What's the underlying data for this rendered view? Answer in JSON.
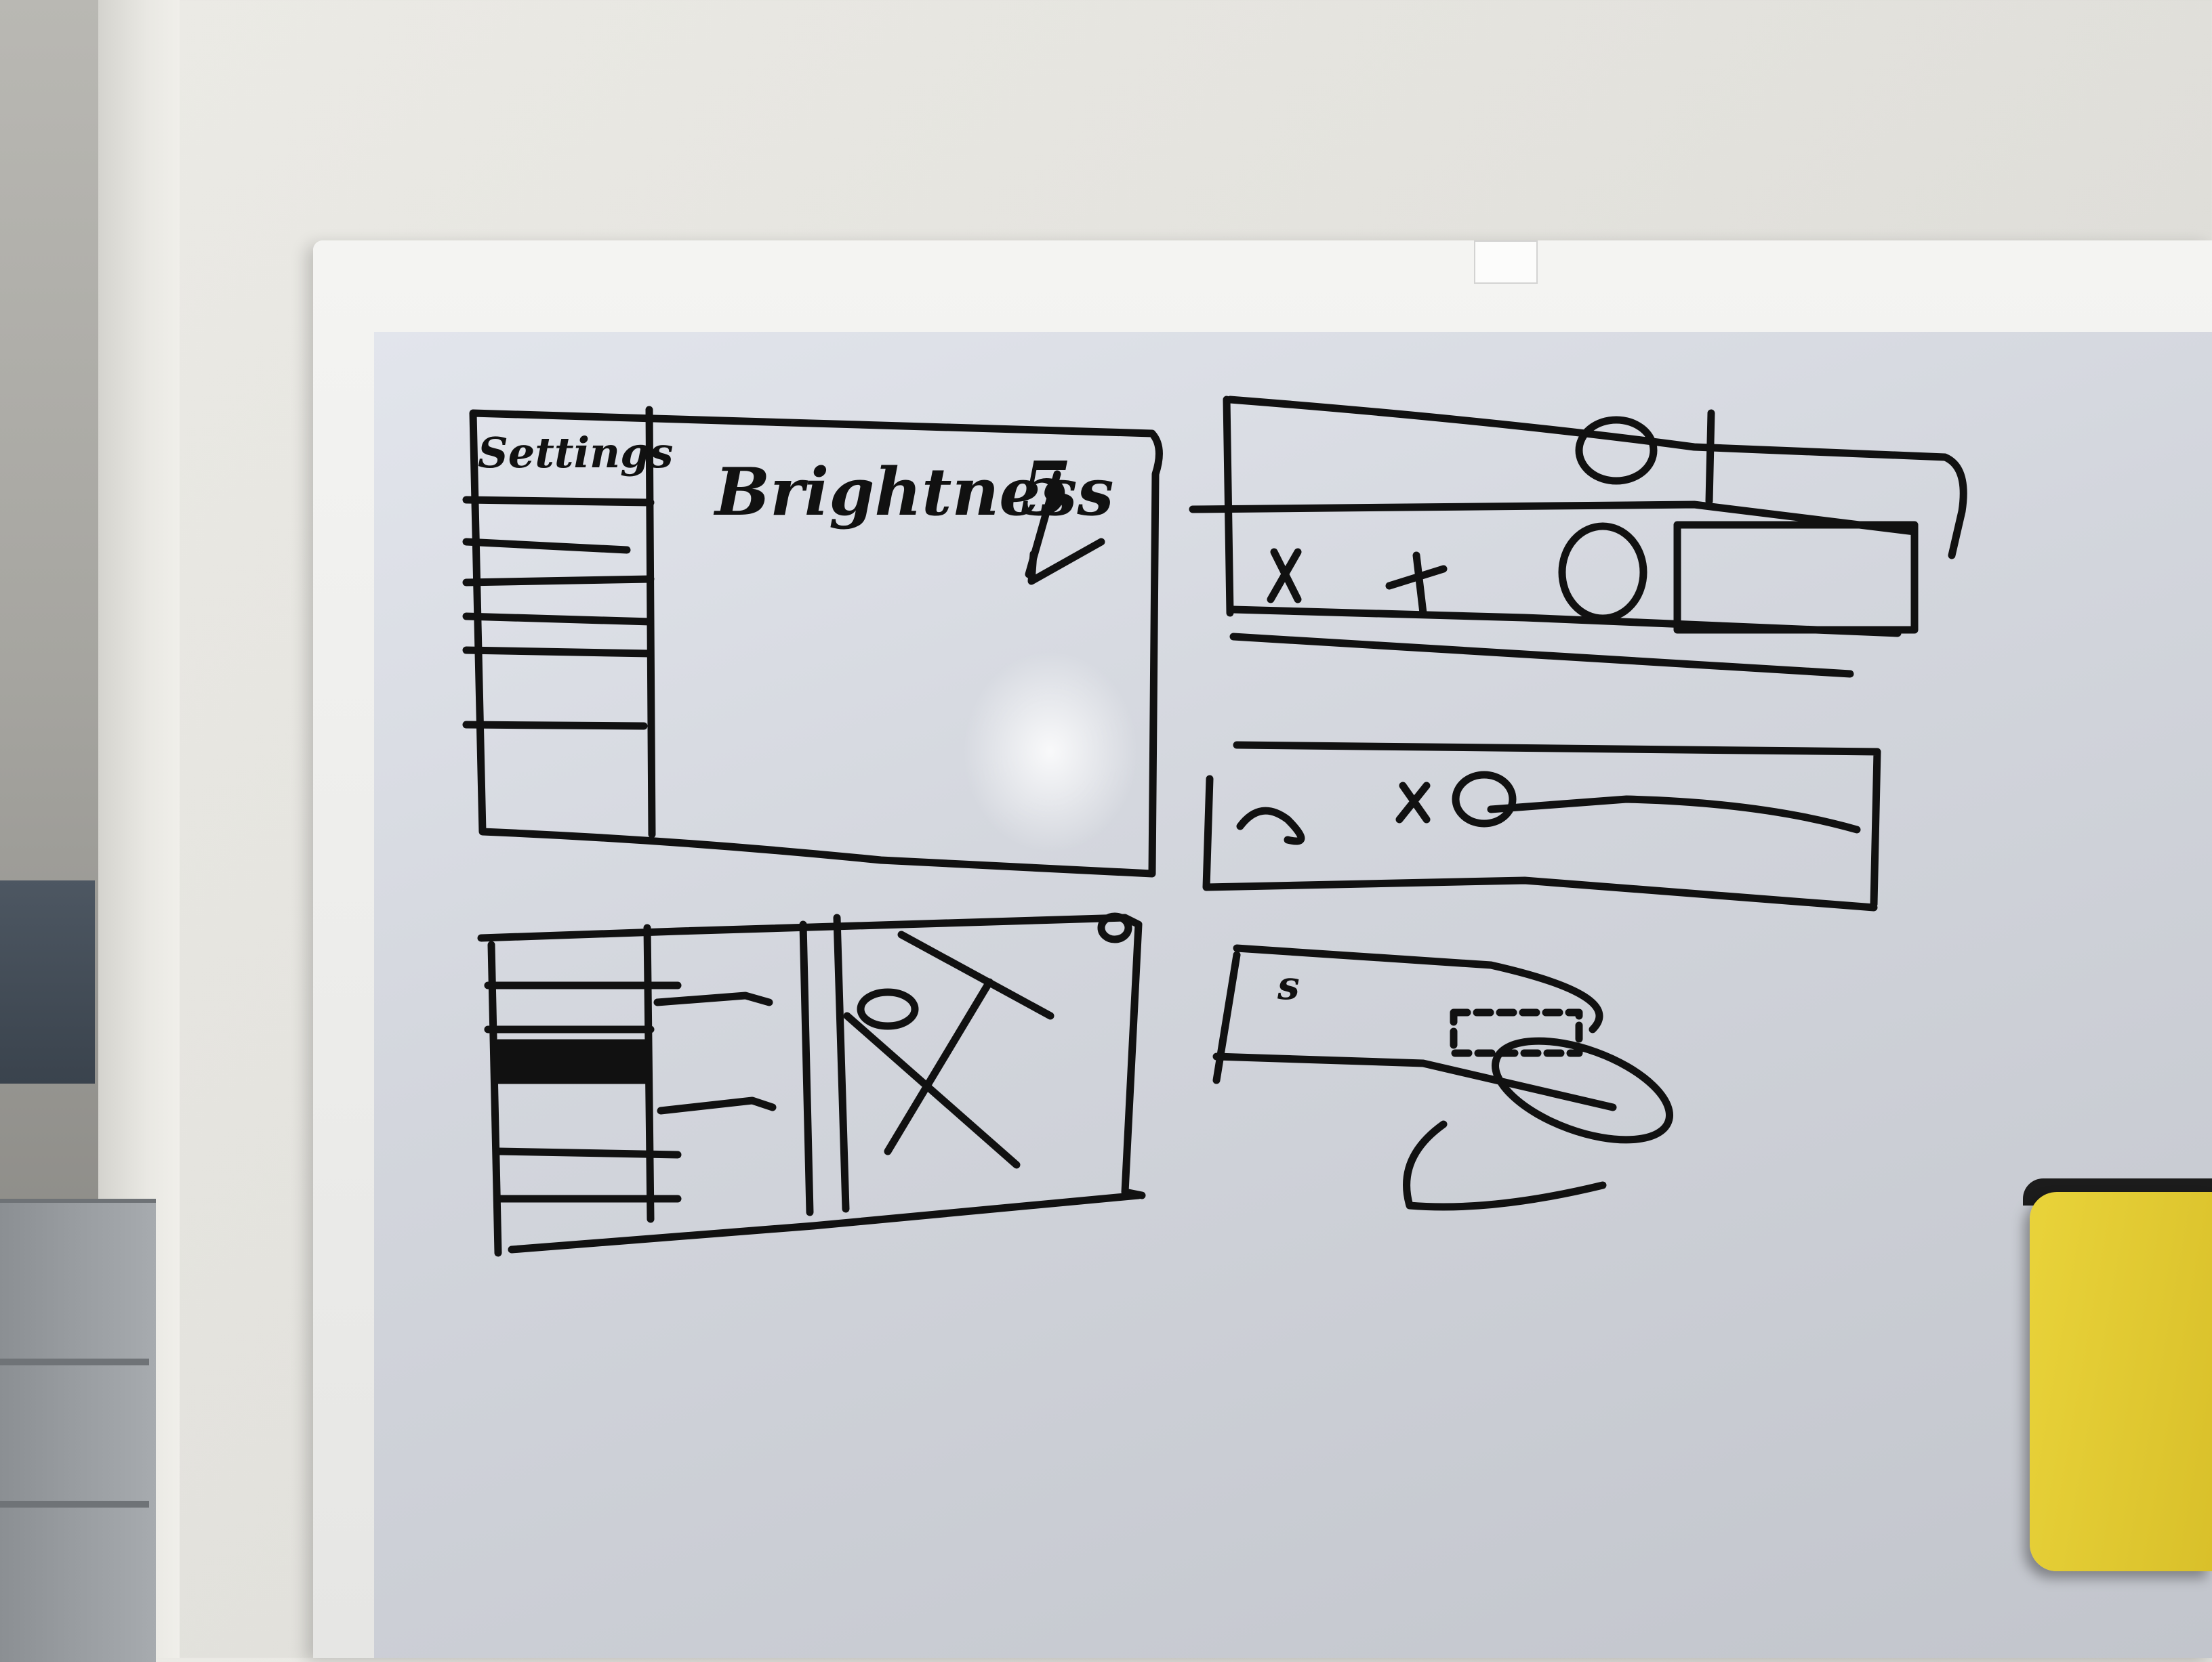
{
  "scene": "whiteboard wireframe sketches",
  "labels": {
    "sidebar_title": "Settings",
    "main_title": "Brightness",
    "main_marker": "5",
    "small_label": "s"
  },
  "colors": {
    "marker": "#111111",
    "eraser": "#e4cc33",
    "board": "#d6d9e0"
  }
}
